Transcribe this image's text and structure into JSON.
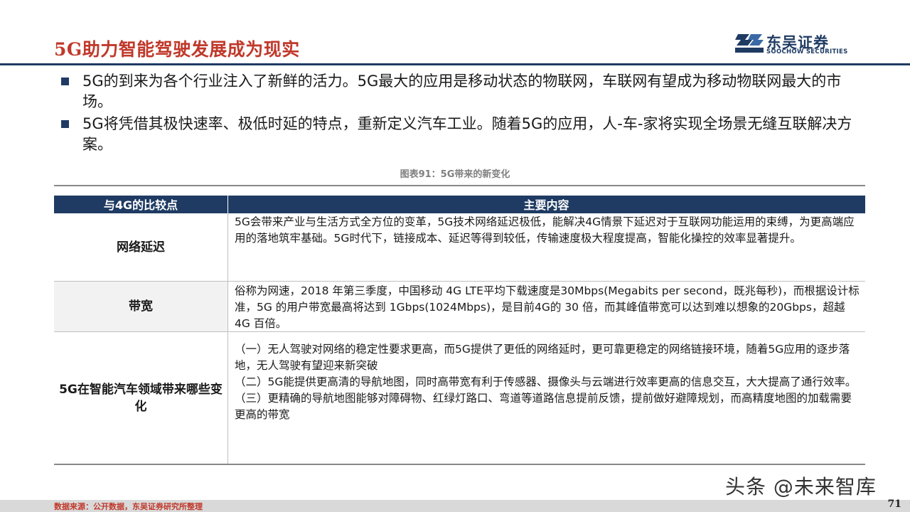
{
  "header": {
    "title": "5G助力智能驾驶发展成为现实",
    "logo_cn": "东吴证券",
    "logo_en": "SOOCHOW SECURITIES",
    "brand_color": "#1f3b63",
    "accent_color": "#c0392b"
  },
  "bullets": [
    "5G的到来为各个行业注入了新鲜的活力。5G最大的应用是移动状态的物联网，车联网有望成为移动物联网最大的市场。",
    "5G将凭借其极快速率、极低时延的特点，重新定义汽车工业。随着5G的应用，人-车-家将实现全场景无缝互联解决方案。"
  ],
  "caption": "图表91：5G带来的新变化",
  "table": {
    "headers": [
      "与4G的比较点",
      "主要内容"
    ],
    "rows": [
      {
        "label": "网络延迟",
        "content": [
          "5G会带来产业与生活方式全方位的变革，5G技术网络延迟极低，能解决4G情景下延迟对于互联网功能运用的束缚，为更高端应用的落地筑牢基础。5G时代下，链接成本、延迟等得到较低，传输速度极大程度提高，智能化操控的效率显著提升。"
        ]
      },
      {
        "label": "带宽",
        "content": [
          "俗称为网速，2018 年第三季度，中国移动 4G LTE平均下载速度是30Mbps(Megabits per second，既兆每秒)，而根据设计标准，5G 的用户带宽最高将达到 1Gbps(1024Mbps)，是目前4G的 30 倍，而其峰值带宽可以达到难以想象的20Gbps，超越 4G 百倍。"
        ]
      },
      {
        "label": "5G在智能汽车领域带来哪些变化",
        "content": [
          "（一）无人驾驶对网络的稳定性要求更高，而5G提供了更低的网络延时，更可靠更稳定的网络链接环境，随着5G应用的逐步落地，无人驾驶有望迎来新突破",
          "（二）5G能提供更高清的导航地图，同时高带宽有利于传感器、摄像头与云端进行效率更高的信息交互，大大提高了通行效率。",
          "（三）更精确的导航地图能够对障碍物、红绿灯路口、弯道等道路信息提前反馈，提前做好避障规划，而高精度地图的加载需要更高的带宽"
        ]
      }
    ]
  },
  "watermark": "头条 @未来智库",
  "footer": {
    "source": "数据来源：公开数据，东吴证券研究所整理",
    "page_number": "71"
  }
}
